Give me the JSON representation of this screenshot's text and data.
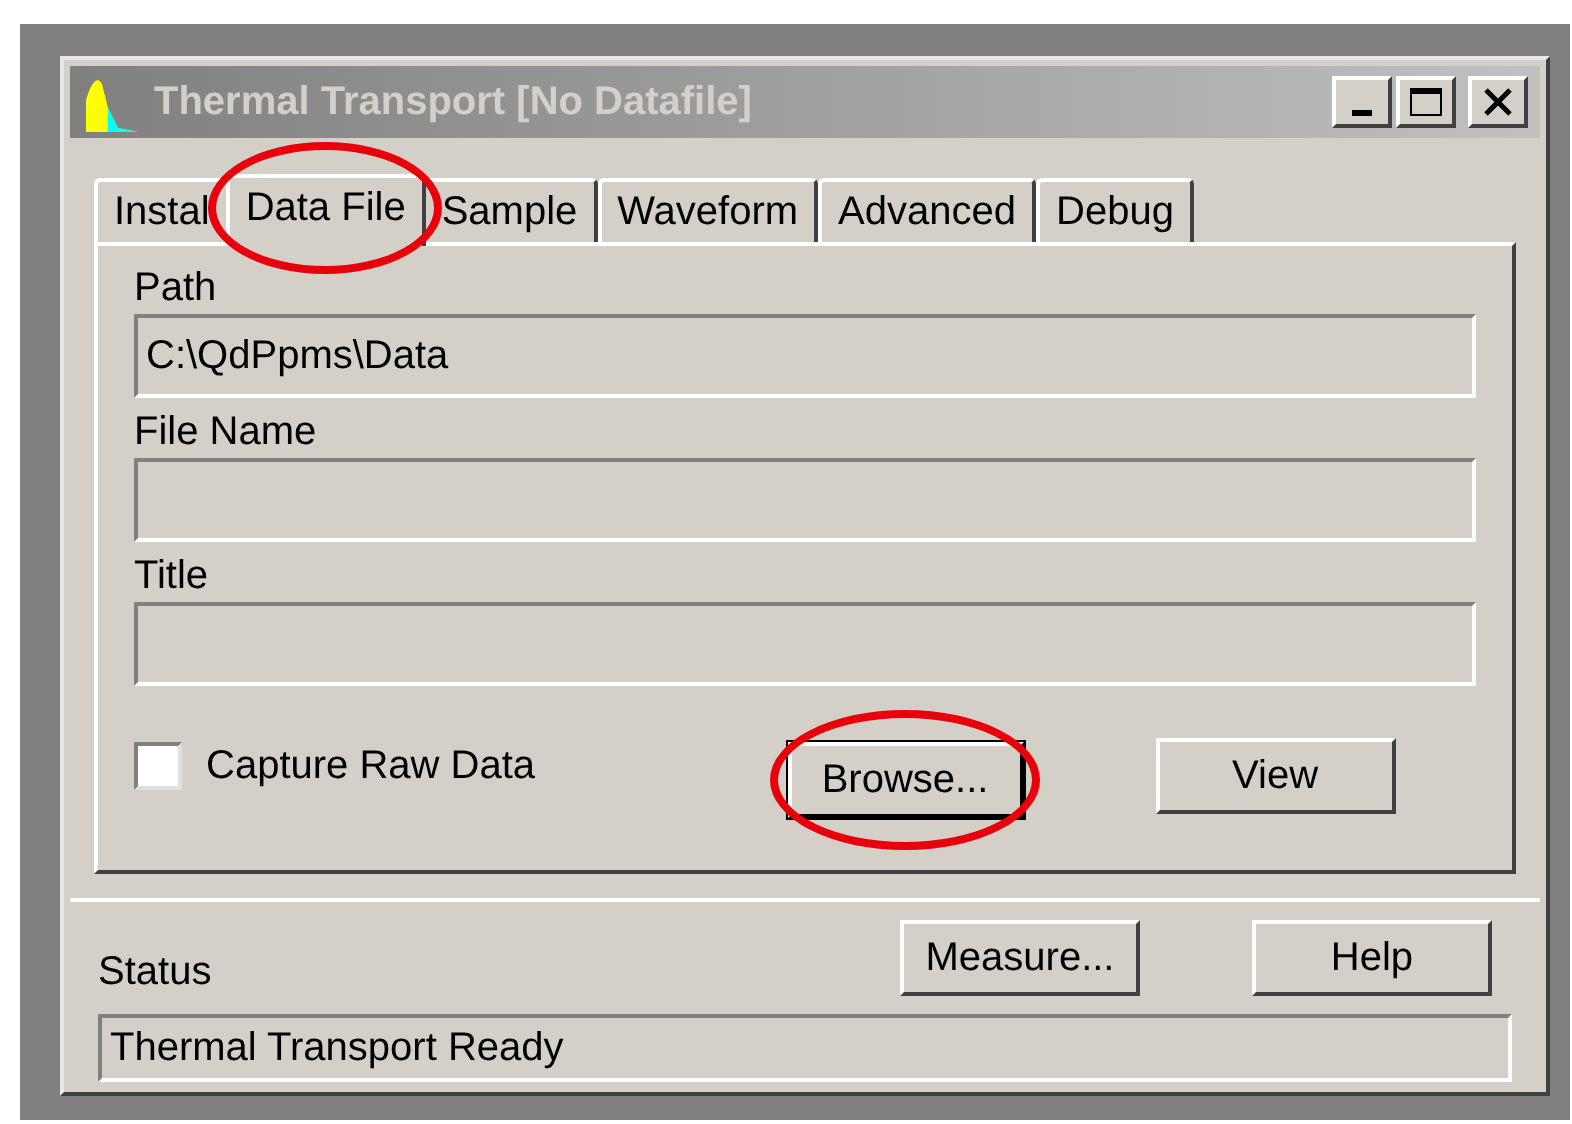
{
  "window": {
    "title": "Thermal Transport [No Datafile]",
    "active": false
  },
  "tabs": [
    {
      "label": "Instal",
      "selected": false,
      "circled": false
    },
    {
      "label": "Data File",
      "selected": true,
      "circled": true
    },
    {
      "label": "Sample",
      "selected": false,
      "circled": false
    },
    {
      "label": "Waveform",
      "selected": false,
      "circled": false
    },
    {
      "label": "Advanced",
      "selected": false,
      "circled": false
    },
    {
      "label": "Debug",
      "selected": false,
      "circled": false
    }
  ],
  "fields": [
    {
      "label": "Path",
      "value": "C:\\QdPpms\\Data"
    },
    {
      "label": "File Name"
    },
    {
      "label": "Title"
    }
  ],
  "checkbox": {
    "label": "Capture Raw Data",
    "checked": false
  },
  "panel_buttons": [
    {
      "label": "Browse...",
      "focused": true,
      "circled": true
    },
    {
      "label": "View",
      "focused": false,
      "circled": false
    }
  ],
  "status": {
    "label": "Status",
    "value": "Thermal Transport Ready"
  },
  "footer_buttons": [
    {
      "label": "Measure..."
    },
    {
      "label": "Help"
    }
  ]
}
